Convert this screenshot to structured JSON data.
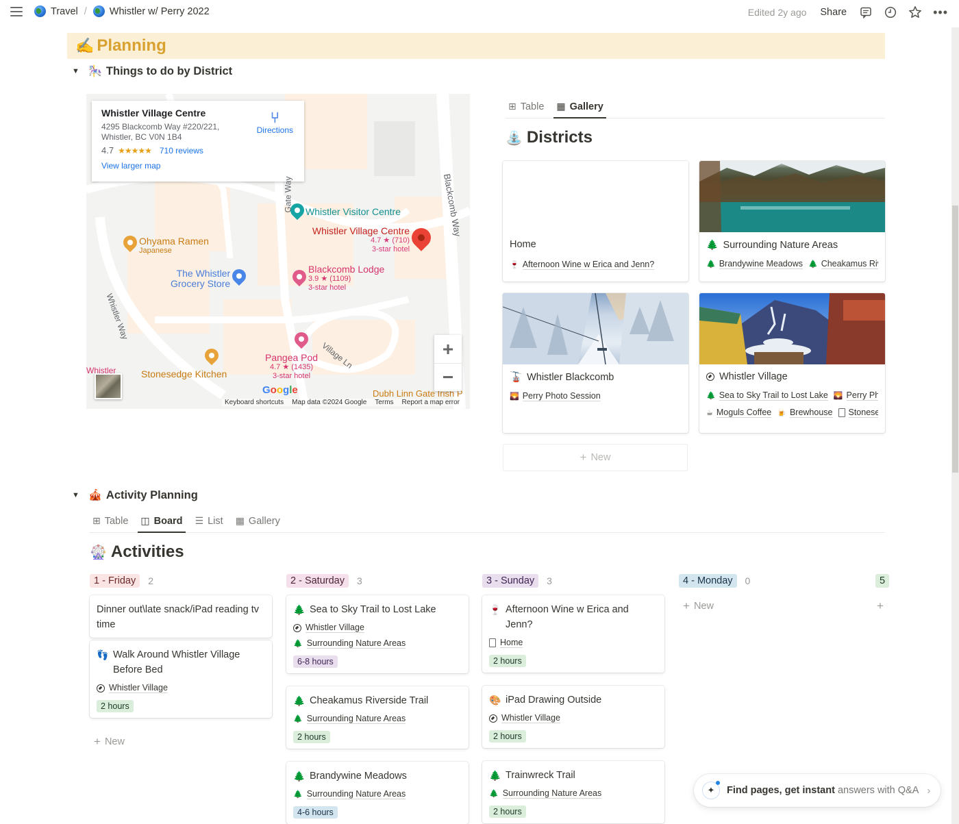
{
  "topbar": {
    "breadcrumb": [
      {
        "icon": "globe-icon",
        "label": "Travel"
      },
      {
        "icon": "globe-icon",
        "label": "Whistler w/ Perry 2022"
      }
    ],
    "separator": "/",
    "edited": "Edited 2y ago",
    "share_label": "Share",
    "more_label": "•••"
  },
  "planning": {
    "icon": "✍️",
    "title": "Planning"
  },
  "things_section": {
    "arrow": "▼",
    "icon": "🎠",
    "title": "Things to do by District"
  },
  "map": {
    "info": {
      "title": "Whistler Village Centre",
      "address_line1": "4295 Blackcomb Way #220/221,",
      "address_line2": "Whistler, BC V0N 1B4",
      "rating": "4.7",
      "stars": "★★★★★",
      "reviews": "710 reviews",
      "larger_map": "View larger map",
      "directions": "Directions"
    },
    "pois": {
      "visitor_centre": "Whistler Visitor Centre",
      "village_centre": {
        "name": "Whistler Village Centre",
        "rating": "4.7 ★ (710)",
        "type": "3-star hotel"
      },
      "ohyama": {
        "name": "Ohyama Ramen",
        "type": "Japanese"
      },
      "grocery": {
        "line1": "The Whistler",
        "line2": "Grocery Store"
      },
      "blackcomb_lodge": {
        "name": "Blackcomb Lodge",
        "rating": "3.9 ★ (1109)",
        "type": "3-star hotel"
      },
      "pangea": {
        "name": "Pangea Pod",
        "rating": "4.7 ★ (1435)",
        "type": "3-star hotel"
      },
      "stonesedge": "Stonesedge Kitchen",
      "dubh_linn": "Dubh Linn Gate Irish P",
      "whistler_partial": "Whistler"
    },
    "streets": {
      "gate_way": "Gate Way",
      "blackcomb_way": "Blackcomb Way",
      "whistler_way": "Whistler Way",
      "village_ln": "Village Ln"
    },
    "google": "Google",
    "zoom_in": "+",
    "zoom_out": "−",
    "footer": [
      "Keyboard shortcuts",
      "Map data ©2024 Google",
      "Terms",
      "Report a map error"
    ]
  },
  "districts": {
    "tabs": [
      {
        "icon": "table-icon",
        "glyph": "⊞",
        "label": "Table",
        "active": false
      },
      {
        "icon": "gallery-icon",
        "glyph": "▦",
        "label": "Gallery",
        "active": true
      }
    ],
    "title_icon": "⛲",
    "title": "Districts",
    "cards": [
      {
        "name": "Home",
        "cover": "none",
        "relations": [
          {
            "icon": "🍷",
            "label": "Afternoon Wine w Erica and Jenn?"
          }
        ]
      },
      {
        "name": "Surrounding Nature Areas",
        "icon": "🌲",
        "cover": "lake-forest",
        "relations": [
          {
            "icon": "🌲",
            "label": "Brandywine Meadows"
          },
          {
            "icon": "🌲",
            "label": "Cheakamus Riverside Trail"
          }
        ]
      },
      {
        "name": "Whistler Blackcomb",
        "icon": "🚡",
        "cover": "snowy-chairlift",
        "relations": [
          {
            "icon": "🌄",
            "label": "Perry Photo Session"
          }
        ]
      },
      {
        "name": "Whistler Village",
        "icon": "compass",
        "cover": "village-mountain",
        "relations": [
          {
            "icon": "🌲",
            "label": "Sea to Sky Trail to Lost Lake"
          },
          {
            "icon": "🌄",
            "label": "Perry Photo Session"
          }
        ],
        "relations2": [
          {
            "icon": "☕",
            "label": "Moguls Coffee"
          },
          {
            "icon": "🍺",
            "label": "Brewhouse"
          },
          {
            "icon": "doc",
            "label": "Stonesedge Kitchen"
          }
        ]
      }
    ],
    "new_label": "New"
  },
  "activity_section": {
    "arrow": "▼",
    "icon": "🎪",
    "title": "Activity Planning",
    "tabs": [
      {
        "icon": "table-icon",
        "glyph": "⊞",
        "label": "Table",
        "active": false
      },
      {
        "icon": "board-icon",
        "glyph": "◫",
        "label": "Board",
        "active": true
      },
      {
        "icon": "list-icon",
        "glyph": "☰",
        "label": "List",
        "active": false
      },
      {
        "icon": "gallery-icon",
        "glyph": "▦",
        "label": "Gallery",
        "active": false
      }
    ],
    "title_icon": "🎡",
    "db_title": "Activities"
  },
  "board": {
    "columns": [
      {
        "label": "1 - Friday",
        "count": "2",
        "bg": "#fbe4e4",
        "fg": "#6b2a2a",
        "cards": [
          {
            "title": "Dinner out\\late snack/iPad reading tv time",
            "icon": "",
            "props": [],
            "tag": null
          },
          {
            "title": "Walk Around Whistler Village Before Bed",
            "icon": "👣",
            "props": [
              {
                "icon": "compass",
                "label": "Whistler Village"
              }
            ],
            "tag": {
              "label": "2 hours",
              "bg": "#dbeddb",
              "fg": "#1c3829"
            }
          }
        ],
        "new_label": "New"
      },
      {
        "label": "2 - Saturday",
        "count": "3",
        "bg": "#f4dfeb",
        "fg": "#4c2337",
        "cards": [
          {
            "title": "Sea to Sky Trail to Lost Lake",
            "icon": "🌲",
            "props": [
              {
                "icon": "compass",
                "label": "Whistler Village"
              },
              {
                "icon": "tree",
                "label": "Surrounding Nature Areas"
              }
            ],
            "tag": {
              "label": "6-8 hours",
              "bg": "#e8deee",
              "fg": "#412454"
            }
          },
          {
            "title": "Cheakamus Riverside Trail",
            "icon": "🌲",
            "props": [
              {
                "icon": "tree",
                "label": "Surrounding Nature Areas"
              }
            ],
            "tag": {
              "label": "2 hours",
              "bg": "#dbeddb",
              "fg": "#1c3829"
            }
          },
          {
            "title": "Brandywine Meadows",
            "icon": "🌲",
            "props": [
              {
                "icon": "tree",
                "label": "Surrounding Nature Areas"
              }
            ],
            "tag": {
              "label": "4-6 hours",
              "bg": "#d3e5ef",
              "fg": "#183347"
            }
          }
        ]
      },
      {
        "label": "3 - Sunday",
        "count": "3",
        "bg": "#e8deee",
        "fg": "#412454",
        "cards": [
          {
            "title": "Afternoon Wine w Erica and Jenn?",
            "icon": "🍷",
            "props": [
              {
                "icon": "doc",
                "label": "Home"
              }
            ],
            "tag": {
              "label": "2 hours",
              "bg": "#dbeddb",
              "fg": "#1c3829"
            }
          },
          {
            "title": "iPad Drawing Outside",
            "icon": "🎨",
            "props": [
              {
                "icon": "compass",
                "label": "Whistler Village"
              }
            ],
            "tag": {
              "label": "2 hours",
              "bg": "#dbeddb",
              "fg": "#1c3829"
            }
          },
          {
            "title": "Trainwreck Trail",
            "icon": "🌲",
            "props": [
              {
                "icon": "tree",
                "label": "Surrounding Nature Areas"
              }
            ],
            "tag": {
              "label": "2 hours",
              "bg": "#dbeddb",
              "fg": "#1c3829"
            }
          }
        ]
      },
      {
        "label": "4 - Monday",
        "count": "0",
        "bg": "#d3e5ef",
        "fg": "#183347",
        "cards": [],
        "new_label": "New"
      },
      {
        "label": "5",
        "count": "",
        "bg": "#dbeddb",
        "fg": "#1c3829",
        "cards": [],
        "new_label": "+"
      }
    ]
  },
  "qa": {
    "text_bold": "Find pages, get instant",
    "text_muted": "answers with Q&A",
    "arrow": "›"
  }
}
